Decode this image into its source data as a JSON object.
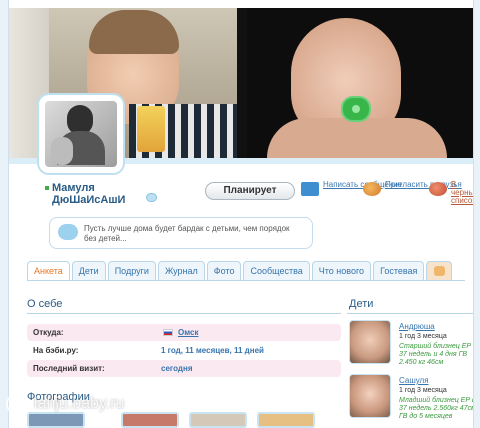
{
  "profile": {
    "name_line1": "Мамуля",
    "name_line2": "ДюШаИсАшИ",
    "plan_button": "Планирует",
    "actions": {
      "message": "Написать сообщение",
      "add_friend": "Пригласить в друзья",
      "blacklist": "В черный список"
    },
    "status_text": "Пусть лучше дома будет бардак с детьми, чем порядок без детей..."
  },
  "tabs": [
    "Анкета",
    "Дети",
    "Подруги",
    "Журнал",
    "Фото",
    "Сообщества",
    "Что нового",
    "Гостевая"
  ],
  "about": {
    "title": "О себе",
    "rows": [
      {
        "label": "Откуда:",
        "value": "Омск"
      },
      {
        "label": "На бэби.ру:",
        "value": "1 год, 11 месяцев, 11 дней"
      },
      {
        "label": "Последний визит:",
        "value": "сегодня"
      }
    ]
  },
  "photos": {
    "title": "Фотографии"
  },
  "kids": {
    "title": "Дети",
    "items": [
      {
        "name": "Андрюша",
        "age": "1 год 3 месяца",
        "info": "Старший близнец ЕР в 37 недель и 4 дня ГВ 2.450 кг 46см"
      },
      {
        "name": "Сашуля",
        "age": "1 год 3 месяца",
        "info": "Младший близнец ЕР в 37 недель 2.560кг 47см ГВ до 5 месяцев"
      }
    ]
  },
  "watermark": "lahju.baby.ru",
  "colors": {
    "link": "#3674ad",
    "accent": "#e6792a",
    "highlight_row": "#fbe9f1",
    "green_text": "#3b9a3f"
  }
}
